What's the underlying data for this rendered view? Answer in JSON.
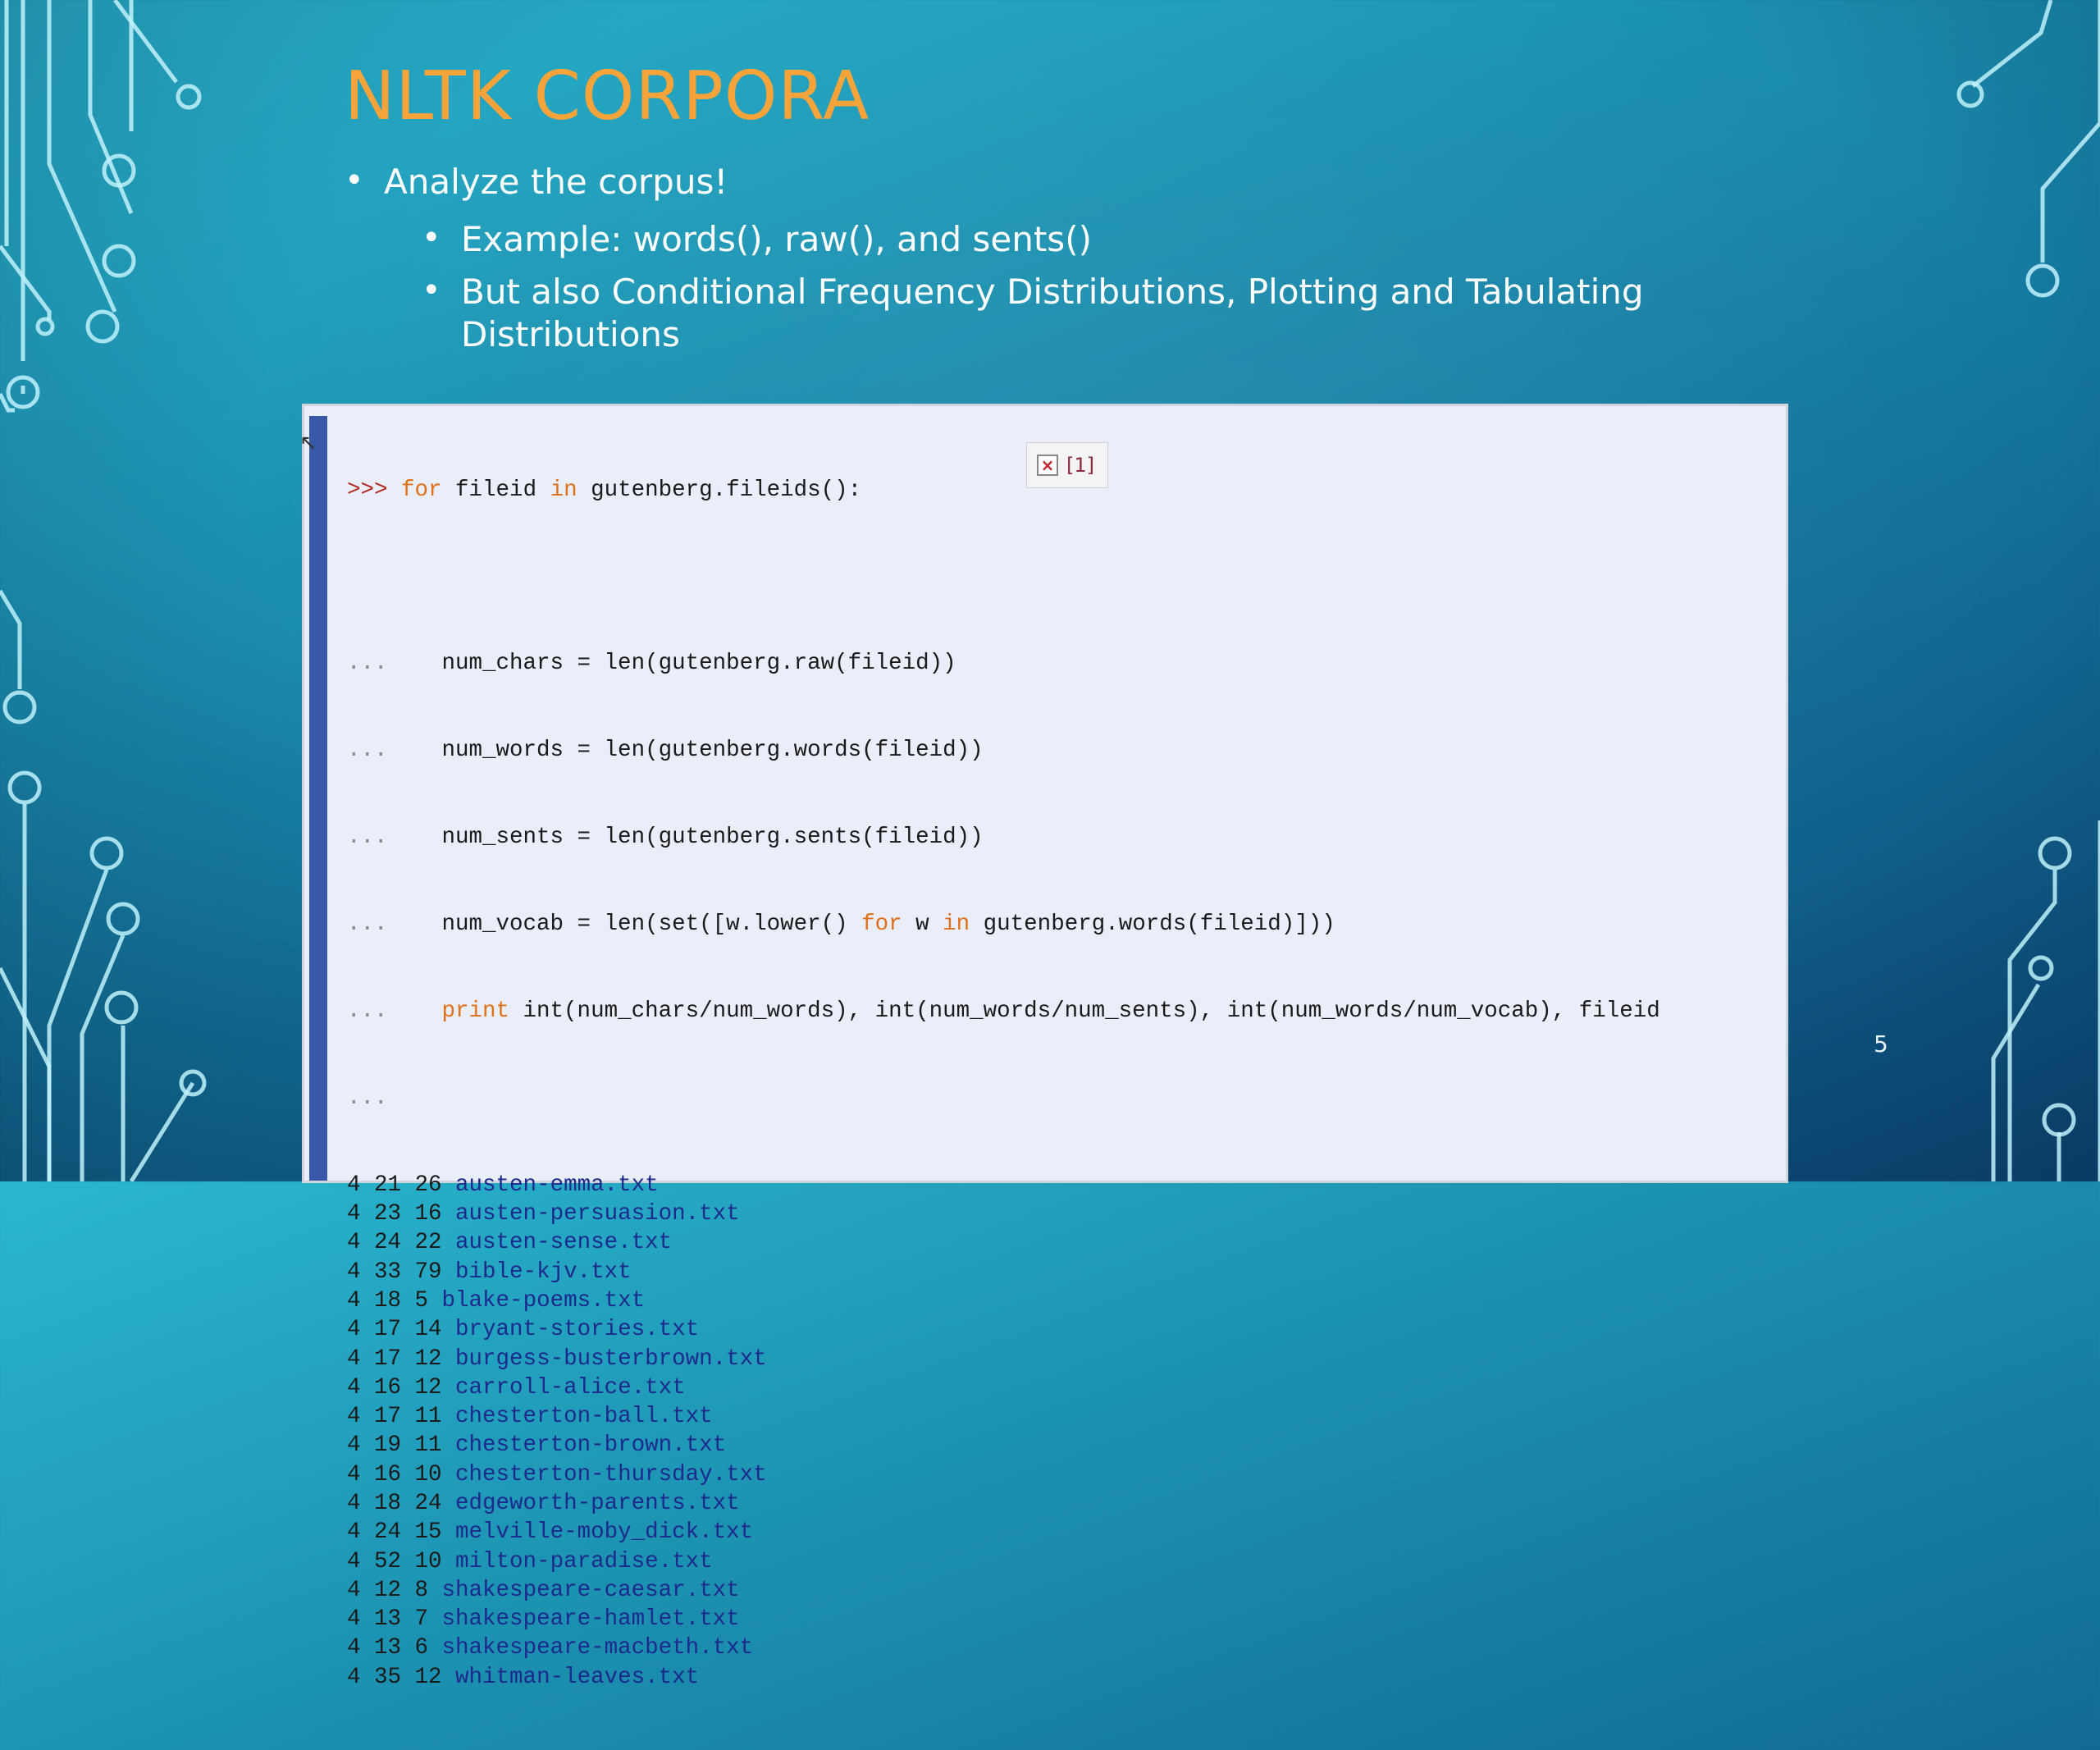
{
  "slide": {
    "title": "NLTK CORPORA",
    "bullet_main": "Analyze the corpus!",
    "sub_bullets": [
      "Example: words(), raw(), and sents()",
      "But also Conditional Frequency Distributions, Plotting and Tabulating Distributions"
    ],
    "page_number": "5"
  },
  "code": {
    "prompt": ">>>",
    "continuation": "...",
    "for_keyword": "for",
    "in_keyword": "in",
    "header_var": " fileid ",
    "header_rest": " gutenberg.fileids():",
    "lines": [
      "    num_chars = len(gutenberg.raw(fileid))",
      "    num_words = len(gutenberg.words(fileid))",
      "    num_sents = len(gutenberg.sents(fileid))"
    ],
    "vocab_pre": "    num_vocab = len(set([w.lower() ",
    "vocab_mid": " w ",
    "vocab_post": " gutenberg.words(fileid)]))",
    "print_kw": "print",
    "print_rest": " int(num_chars/num_words), int(num_words/num_sents), int(num_words/num_vocab), fileid",
    "output": [
      {
        "nums": "4 21 26",
        "file": "austen-emma.txt"
      },
      {
        "nums": "4 23 16",
        "file": "austen-persuasion.txt"
      },
      {
        "nums": "4 24 22",
        "file": "austen-sense.txt"
      },
      {
        "nums": "4 33 79",
        "file": "bible-kjv.txt"
      },
      {
        "nums": "4 18 5",
        "file": "blake-poems.txt"
      },
      {
        "nums": "4 17 14",
        "file": "bryant-stories.txt"
      },
      {
        "nums": "4 17 12",
        "file": "burgess-busterbrown.txt"
      },
      {
        "nums": "4 16 12",
        "file": "carroll-alice.txt"
      },
      {
        "nums": "4 17 11",
        "file": "chesterton-ball.txt"
      },
      {
        "nums": "4 19 11",
        "file": "chesterton-brown.txt"
      },
      {
        "nums": "4 16 10",
        "file": "chesterton-thursday.txt"
      },
      {
        "nums": "4 18 24",
        "file": "edgeworth-parents.txt"
      },
      {
        "nums": "4 24 15",
        "file": "melville-moby_dick.txt"
      },
      {
        "nums": "4 52 10",
        "file": "milton-paradise.txt"
      },
      {
        "nums": "4 12 8",
        "file": "shakespeare-caesar.txt"
      },
      {
        "nums": "4 13 7",
        "file": "shakespeare-hamlet.txt"
      },
      {
        "nums": "4 13 6",
        "file": "shakespeare-macbeth.txt"
      },
      {
        "nums": "4 35 12",
        "file": "whitman-leaves.txt"
      }
    ]
  },
  "popup": {
    "close_symbol": "×",
    "reference": "[1]"
  },
  "icons": {
    "circuit_decoration": "circuit-board-icon",
    "close": "close-icon"
  },
  "colors": {
    "title": "#f6a33a",
    "keyword": "#e0701a",
    "prompt": "#b3261e",
    "filename": "#1b2a8c",
    "gutter": "#3a58a8"
  }
}
